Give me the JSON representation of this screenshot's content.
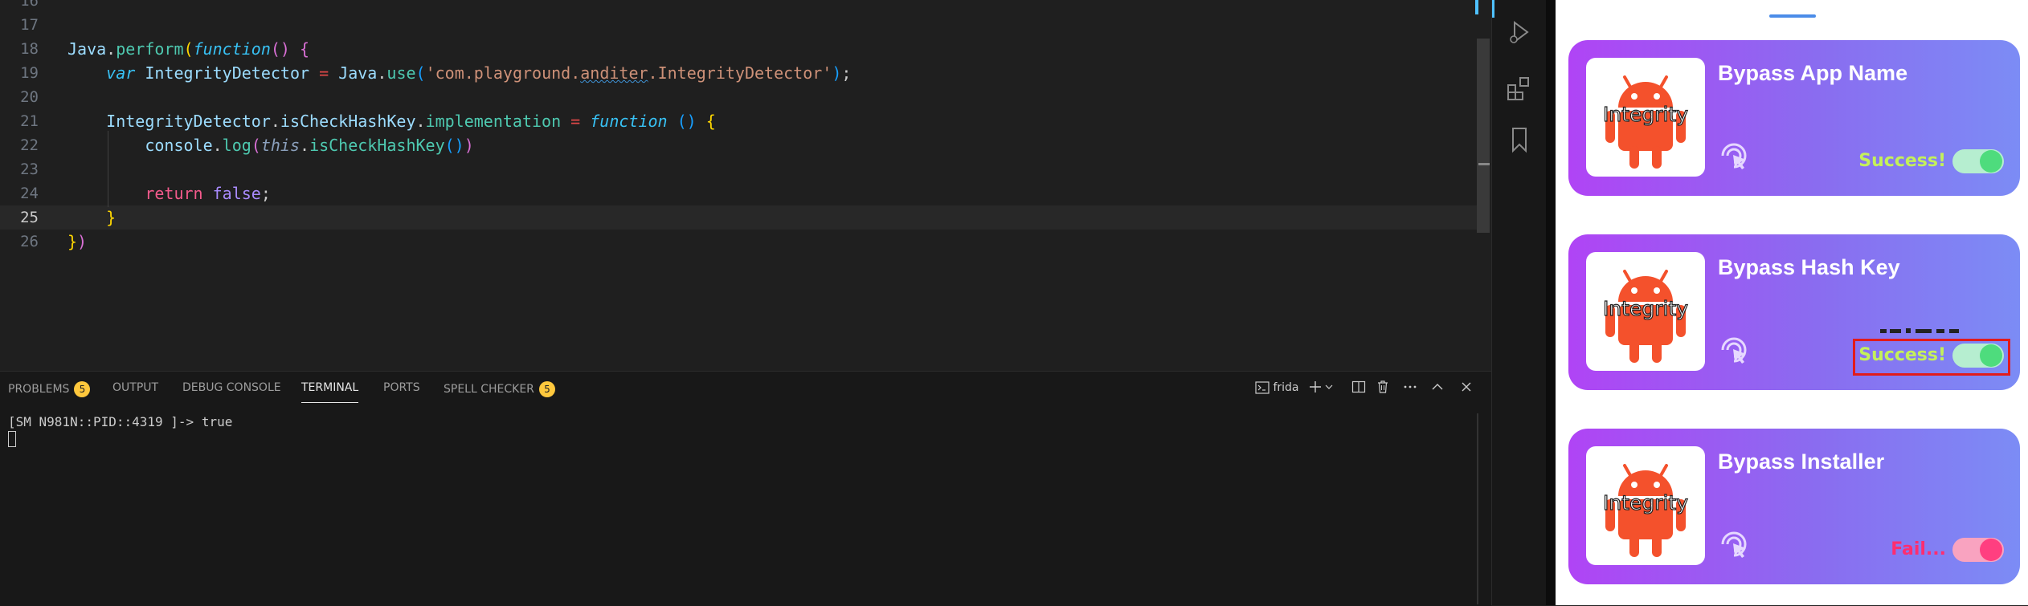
{
  "editor": {
    "partial_top_line_number": "16",
    "current_line": "25",
    "lines": [
      {
        "n": "17",
        "tokens": []
      },
      {
        "n": "18",
        "tokens": [
          [
            "t-obj",
            "Java"
          ],
          [
            "t-pl",
            "."
          ],
          [
            "t-fn",
            "perform"
          ],
          [
            "t-br1",
            "("
          ],
          [
            "t-kw",
            "function"
          ],
          [
            "t-br2",
            "()"
          ],
          [
            "t-pl",
            " "
          ],
          [
            "t-br2",
            "{"
          ]
        ]
      },
      {
        "n": "19",
        "tokens": [
          [
            "t-pl",
            "    "
          ],
          [
            "t-kw",
            "var"
          ],
          [
            "t-pl",
            " "
          ],
          [
            "t-obj",
            "IntegrityDetector"
          ],
          [
            "t-pl",
            " "
          ],
          [
            "t-eq",
            "="
          ],
          [
            "t-pl",
            " "
          ],
          [
            "t-obj",
            "Java"
          ],
          [
            "t-pl",
            "."
          ],
          [
            "t-fn",
            "use"
          ],
          [
            "t-br3",
            "("
          ],
          [
            "t-str",
            "'"
          ],
          [
            "t-str",
            "com.playground."
          ],
          [
            "t-str squig",
            "anditer"
          ],
          [
            "t-str",
            ".IntegrityDetector'"
          ],
          [
            "t-br3",
            ")"
          ],
          [
            "t-pl",
            ";"
          ]
        ]
      },
      {
        "n": "20",
        "tokens": []
      },
      {
        "n": "21",
        "tokens": [
          [
            "t-pl",
            "    "
          ],
          [
            "t-obj",
            "IntegrityDetector"
          ],
          [
            "t-pl",
            "."
          ],
          [
            "t-obj",
            "isCheckHashKey"
          ],
          [
            "t-pl",
            "."
          ],
          [
            "t-fn",
            "implementation"
          ],
          [
            "t-pl",
            " "
          ],
          [
            "t-eq",
            "="
          ],
          [
            "t-pl",
            " "
          ],
          [
            "t-kw",
            "function"
          ],
          [
            "t-pl",
            " "
          ],
          [
            "t-br3",
            "()"
          ],
          [
            "t-pl",
            " "
          ],
          [
            "t-br1",
            "{"
          ]
        ]
      },
      {
        "n": "22",
        "tokens": [
          [
            "t-pl",
            "        "
          ],
          [
            "t-obj",
            "console"
          ],
          [
            "t-pl",
            "."
          ],
          [
            "t-fn",
            "log"
          ],
          [
            "t-br2",
            "("
          ],
          [
            "t-this",
            "this"
          ],
          [
            "t-pl",
            "."
          ],
          [
            "t-meth",
            "isCheckHashKey"
          ],
          [
            "t-br3",
            "()"
          ],
          [
            "t-br2",
            ")"
          ]
        ]
      },
      {
        "n": "23",
        "tokens": []
      },
      {
        "n": "24",
        "tokens": [
          [
            "t-pl",
            "        "
          ],
          [
            "t-ret",
            "return"
          ],
          [
            "t-pl",
            " "
          ],
          [
            "t-bool",
            "false"
          ],
          [
            "t-pl",
            ";"
          ]
        ]
      },
      {
        "n": "25",
        "tokens": [
          [
            "t-pl",
            "    "
          ],
          [
            "t-br1",
            "}"
          ]
        ]
      },
      {
        "n": "26",
        "tokens": [
          [
            "t-br1",
            "}"
          ],
          [
            "t-br2",
            ")"
          ]
        ]
      }
    ]
  },
  "panel": {
    "tabs": [
      {
        "label": "PROBLEMS",
        "badge": "5",
        "active": false
      },
      {
        "label": "OUTPUT",
        "badge": "",
        "active": false
      },
      {
        "label": "DEBUG CONSOLE",
        "badge": "",
        "active": false
      },
      {
        "label": "TERMINAL",
        "badge": "",
        "active": true
      },
      {
        "label": "PORTS",
        "badge": "",
        "active": false
      },
      {
        "label": "SPELL CHECKER",
        "badge": "5",
        "active": false
      }
    ],
    "terminal_name": "frida",
    "terminal_output": "[SM N981N::PID::4319 ]-> true"
  },
  "activity_icons": [
    "run-debug-icon",
    "extensions-icon",
    "bookmark-icon"
  ],
  "colors": {
    "accent": "#4fc1ff",
    "card_gradient_start": "#b044f5",
    "card_gradient_end": "#7c8cf5",
    "success": "#c4f05a",
    "fail": "#ff2d70",
    "highlight_border": "#e21b1b"
  },
  "app": {
    "cards": [
      {
        "title": "Bypass App Name",
        "thumb_label": "Integrity",
        "status": "Success!",
        "state": "success",
        "toggle": "on",
        "highlighted": false
      },
      {
        "title": "Bypass Hash Key",
        "thumb_label": "Integrity",
        "status": "Success!",
        "state": "success",
        "toggle": "on",
        "highlighted": true
      },
      {
        "title": "Bypass Installer",
        "thumb_label": "Integrity",
        "status": "Fail...",
        "state": "fail",
        "toggle": "off",
        "highlighted": false
      }
    ]
  }
}
